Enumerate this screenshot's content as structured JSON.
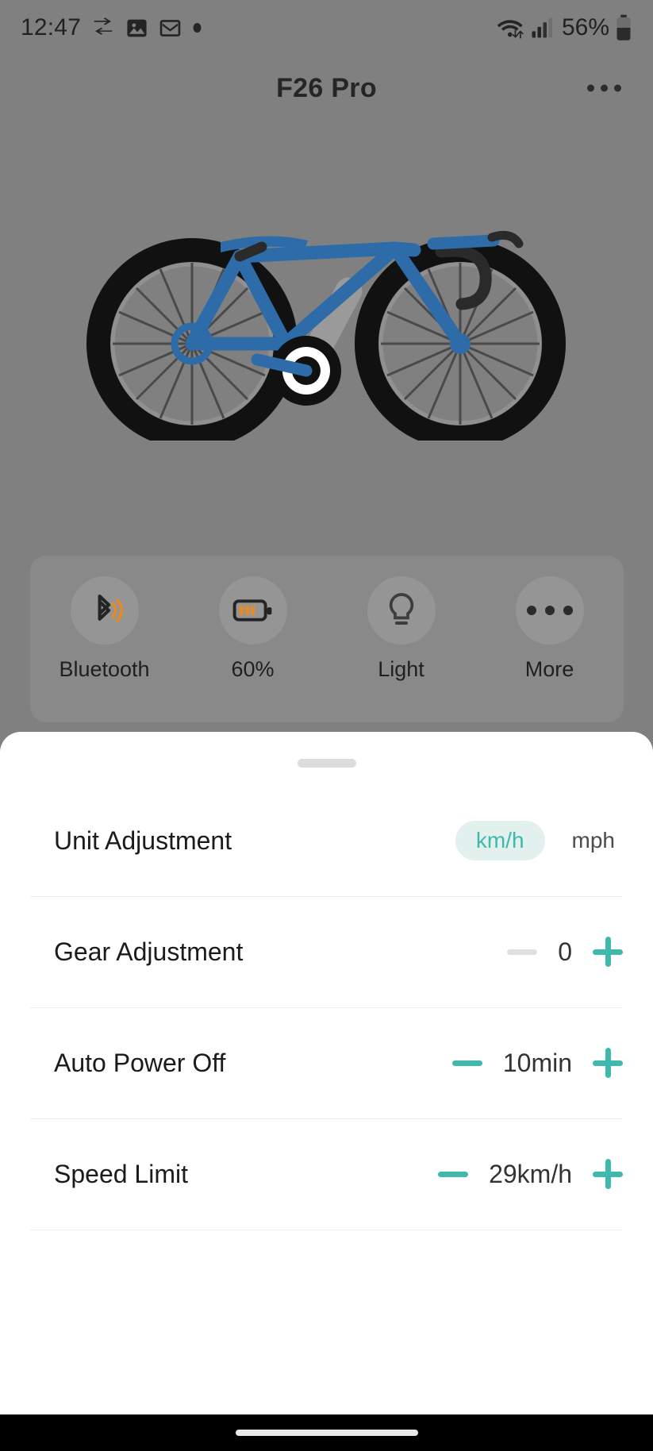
{
  "status_bar": {
    "time": "12:47",
    "battery_percent": "56%",
    "icons": [
      "transfer-arrows-icon",
      "photo-icon",
      "mail-icon",
      "dot-icon",
      "wifi-icon",
      "cellular-signal-icon",
      "battery-icon"
    ]
  },
  "header": {
    "title": "F26 Pro",
    "overflow_icon": "more-horizontal-icon"
  },
  "illustration": {
    "name": "bicycle-illustration",
    "frame_color": "#2d6ca8",
    "tire_color": "#121212",
    "rim_color": "#8c8c8c"
  },
  "quick_actions": [
    {
      "id": "bluetooth",
      "icon": "bluetooth-icon",
      "label": "Bluetooth"
    },
    {
      "id": "battery",
      "icon": "battery-icon",
      "label": "60%"
    },
    {
      "id": "light",
      "icon": "light-bulb-icon",
      "label": "Light"
    },
    {
      "id": "more",
      "icon": "more-horizontal-icon",
      "label": "More"
    }
  ],
  "sheet": {
    "handle": "drag-handle",
    "rows": [
      {
        "id": "unit-adjustment",
        "label": "Unit Adjustment",
        "type": "segmented",
        "selected": "km/h",
        "options": [
          "km/h",
          "mph"
        ]
      },
      {
        "id": "gear-adjustment",
        "label": "Gear Adjustment",
        "type": "stepper",
        "value": "0",
        "minus_enabled": false,
        "plus_enabled": true
      },
      {
        "id": "auto-power-off",
        "label": "Auto Power Off",
        "type": "stepper",
        "value": "10min",
        "minus_enabled": true,
        "plus_enabled": true
      },
      {
        "id": "speed-limit",
        "label": "Speed Limit",
        "type": "stepper",
        "value": "29km/h",
        "minus_enabled": true,
        "plus_enabled": true
      }
    ]
  },
  "colors": {
    "accent_teal": "#3fb9ac",
    "accent_pill_bg": "#e3f1ee",
    "disabled_gray": "#e0e0e0",
    "battery_orange": "#e08b2c",
    "scrim": "#808080"
  },
  "nav_bar": {
    "pill": "home-indicator"
  }
}
